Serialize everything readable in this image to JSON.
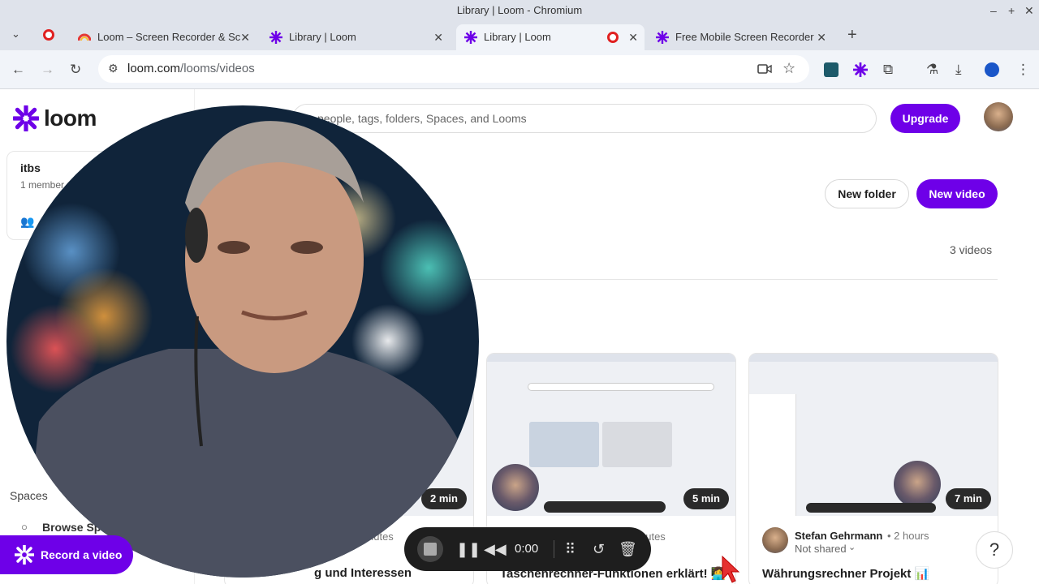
{
  "window": {
    "title": "Library | Loom - Chromium"
  },
  "tabs": [
    {
      "label": "Loom – Screen Recorder & Sc"
    },
    {
      "label": "Library | Loom"
    },
    {
      "label": "Library | Loom"
    },
    {
      "label": "Free Mobile Screen Recorder"
    }
  ],
  "omnibox": {
    "host": "loom.com",
    "path": "/looms/videos"
  },
  "brand": {
    "name": "loom",
    "accent": "#6e00e8"
  },
  "sidebar": {
    "workspace_name": "itbs",
    "workspace_members": "1 member",
    "spaces_heading": "Spaces",
    "browse_spaces": "Browse Sp",
    "record_button": "Record a video"
  },
  "header": {
    "search_placeholder": "people, tags, folders, Spaces, and Looms",
    "upgrade_label": "Upgrade"
  },
  "library": {
    "new_folder_label": "New folder",
    "new_video_label": "New video",
    "video_count": "3 videos"
  },
  "videos": [
    {
      "duration": "2 min",
      "meta_tail": "nutes",
      "title_tail": "g und Interessen"
    },
    {
      "duration": "5 min",
      "meta_tail": "nutes",
      "title_tail": "Taschenrechner-Funktionen erklärt! 👩‍💻"
    },
    {
      "duration": "7 min",
      "author": "Stefan Gehrmann",
      "time": "• 2 hours",
      "sharing": "Not shared",
      "title": "Währungsrechner Projekt 📊"
    }
  ],
  "recorder": {
    "timer": "0:00"
  },
  "help": {
    "label": "?"
  }
}
